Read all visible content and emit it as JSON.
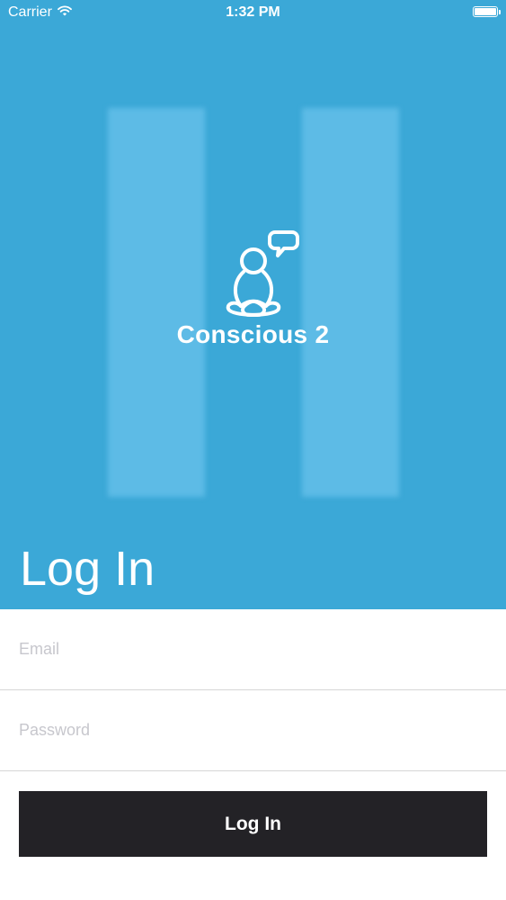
{
  "status_bar": {
    "carrier": "Carrier",
    "time": "1:32 PM",
    "icons": [
      "wifi-icon",
      "battery-icon"
    ]
  },
  "hero": {
    "brand_name": "Conscious 2",
    "logo_icon": "meditating-person-with-speech-bubble-icon",
    "background_color": "#3ba8d7"
  },
  "page": {
    "title": "Log In"
  },
  "form": {
    "email_placeholder": "Email",
    "email_value": "",
    "password_placeholder": "Password",
    "password_value": "",
    "submit_label": "Log In",
    "submit_color": "#232226"
  }
}
